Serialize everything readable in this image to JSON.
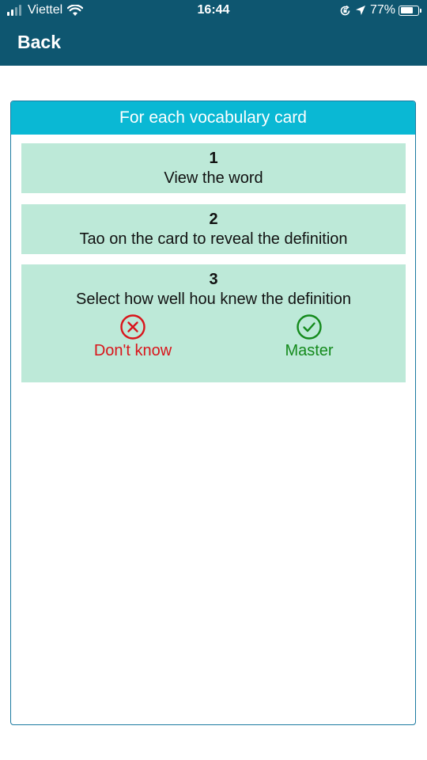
{
  "status_bar": {
    "carrier": "Viettel",
    "time": "16:44",
    "battery_percent": "77%",
    "battery_level": 0.77,
    "icons": [
      "signal-icon",
      "wifi-icon",
      "orientation-lock-icon",
      "location-arrow-icon",
      "battery-icon"
    ]
  },
  "nav": {
    "back_label": "Back"
  },
  "panel": {
    "header": "For each vocabulary card",
    "steps": [
      {
        "number": "1",
        "text": "View the word"
      },
      {
        "number": "2",
        "text": "Tao on the card to reveal the definition"
      },
      {
        "number": "3",
        "text": "Select how well hou knew the definition"
      }
    ],
    "choices": {
      "dont_know": {
        "label": "Don't know",
        "icon": "x-circle-icon",
        "color": "#d9151b"
      },
      "master": {
        "label": "Master",
        "icon": "check-circle-icon",
        "color": "#148a1c"
      }
    }
  },
  "colors": {
    "nav_bg": "#0e5670",
    "header_bg": "#0ab8d4",
    "step_bg": "#bde9d8",
    "panel_border": "#1b7aa0"
  }
}
